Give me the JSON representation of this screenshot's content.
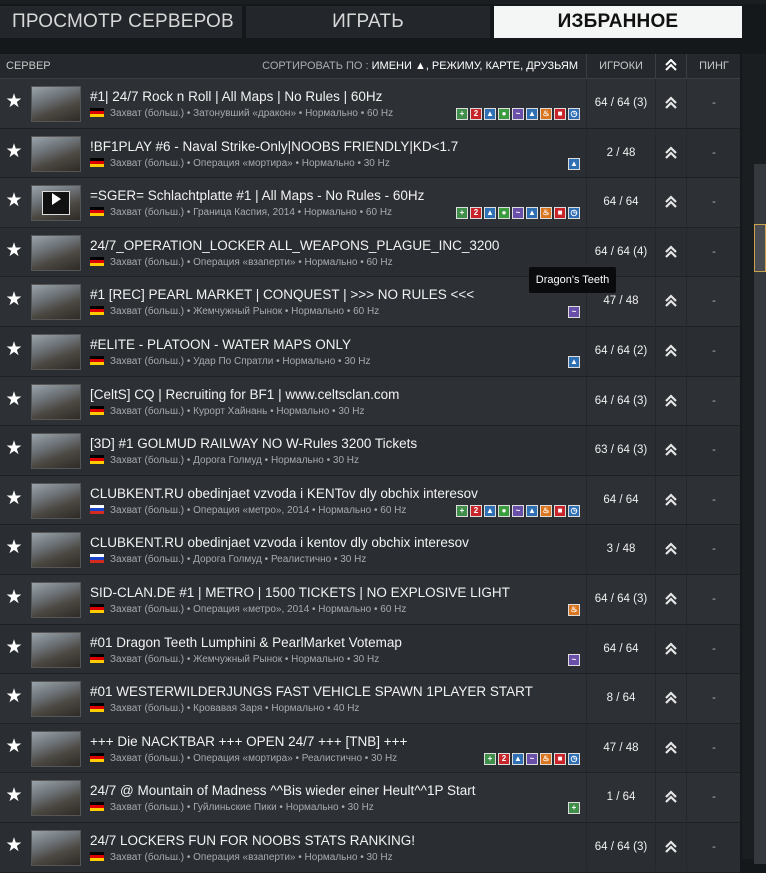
{
  "tabs": {
    "browse": "ПРОСМОТР СЕРВЕРОВ",
    "play": "ИГРАТЬ",
    "favorites": "ИЗБРАННОЕ"
  },
  "header": {
    "server": "СЕРВЕР",
    "sort_label": "СОРТИРОВАТЬ ПО :",
    "sort_options": "ИМЕНИ ▲, РЕЖИМУ, КАРТЕ, ДРУЗЬЯМ",
    "players": "ИГРОКИ",
    "ping": "ПИНГ"
  },
  "tooltip": "Dragon's Teeth",
  "servers": [
    {
      "name": "#1| 24/7 Rock n Roll | All Maps | No Rules | 60Hz",
      "sub": "Захват (больш.) • Затонувший «дракон» • Нормально • 60 Hz",
      "flag": "de",
      "players": "64 / 64 (3)",
      "ping": "-",
      "tags": [
        "green-plus",
        "red-2",
        "blue-ship",
        "green-circle",
        "purple-wave",
        "blue-mountain",
        "orange-fire",
        "red-square",
        "blue-clock"
      ],
      "video": false
    },
    {
      "name": "!BF1PLAY #6 - Naval Strike-Only|NOOBS FRIENDLY|KD<1.7",
      "sub": "Захват (больш.) • Операция «мортира» • Нормально • 30 Hz",
      "flag": "de",
      "players": "2 / 48",
      "ping": "-",
      "tags": [
        "blue-mountain"
      ],
      "video": false
    },
    {
      "name": "=SGER= Schlachtplatte #1 | All Maps - No Rules - 60Hz",
      "sub": "Захват (больш.) • Граница Каспия, 2014 • Нормально • 60 Hz",
      "flag": "de",
      "players": "64 / 64",
      "ping": "-",
      "tags": [
        "green-plus",
        "red-2",
        "blue-ship",
        "green-circle",
        "purple-wave",
        "blue-mountain",
        "orange-fire",
        "red-square",
        "blue-clock"
      ],
      "video": true
    },
    {
      "name": "24/7_OPERATION_LOCKER ALL_WEAPONS_PLAGUE_INC_3200",
      "sub": "Захват (больш.) • Операция «взаперти» • Нормально • 60 Hz",
      "flag": "de",
      "players": "64 / 64 (4)",
      "ping": "-",
      "tags": [],
      "video": false
    },
    {
      "name": "#1 [REC] PEARL MARKET | CONQUEST | >>> NO RULES <<<",
      "sub": "Захват (больш.) • Жемчужный Рынок • Нормально • 60 Hz",
      "flag": "de",
      "players": "47 / 48",
      "ping": "-",
      "tags": [
        "purple-wave"
      ],
      "video": false
    },
    {
      "name": "#ELITE - PLATOON - WATER MAPS ONLY",
      "sub": "Захват (больш.) • Удар По Спратли • Нормально • 30 Hz",
      "flag": "de",
      "players": "64 / 64 (2)",
      "ping": "-",
      "tags": [
        "blue-mountain"
      ],
      "video": false
    },
    {
      "name": "[CeltS] CQ | Recruiting for BF1 | www.celtsclan.com",
      "sub": "Захват (больш.) • Курорт Хайнань • Нормально • 30 Hz",
      "flag": "de",
      "players": "64 / 64 (3)",
      "ping": "-",
      "tags": [],
      "video": false
    },
    {
      "name": "[3D] #1 GOLMUD RAILWAY NO W-Rules 3200 Tickets",
      "sub": "Захват (больш.) • Дорога Голмуд • Нормально • 30 Hz",
      "flag": "de",
      "players": "63 / 64 (3)",
      "ping": "-",
      "tags": [],
      "video": false
    },
    {
      "name": "CLUBKENT.RU obedinjaet vzvoda i KENTov dly obchix interesov",
      "sub": "Захват (больш.) • Операция «метро», 2014 • Нормально • 60 Hz",
      "flag": "ru",
      "players": "64 / 64",
      "ping": "-",
      "tags": [
        "green-plus",
        "red-2",
        "blue-ship",
        "green-circle",
        "purple-wave",
        "blue-mountain",
        "orange-fire",
        "red-square",
        "blue-clock"
      ],
      "video": false
    },
    {
      "name": "CLUBKENT.RU obedinjaet vzvoda i kentov dly obchix interesov",
      "sub": "Захват (больш.) • Дорога Голмуд • Реалистично • 30 Hz",
      "flag": "ru",
      "players": "3 / 48",
      "ping": "-",
      "tags": [],
      "video": false
    },
    {
      "name": "SID-CLAN.DE #1 | METRO | 1500 TICKETS | NO EXPLOSIVE LIGHT",
      "sub": "Захват (больш.) • Операция «метро», 2014 • Нормально • 60 Hz",
      "flag": "de",
      "players": "64 / 64 (3)",
      "ping": "-",
      "tags": [
        "orange-fire"
      ],
      "video": false
    },
    {
      "name": "#01 Dragon Teeth Lumphini & PearlMarket Votemap",
      "sub": "Захват (больш.) • Жемчужный Рынок • Нормально • 30 Hz",
      "flag": "de",
      "players": "64 / 64",
      "ping": "-",
      "tags": [
        "purple-wave"
      ],
      "video": false
    },
    {
      "name": "#01 WESTERWILDERJUNGS FAST VEHICLE SPAWN 1PLAYER START",
      "sub": "Захват (больш.) • Кровавая Заря • Нормально • 40 Hz",
      "flag": "de",
      "players": "8 / 64",
      "ping": "-",
      "tags": [],
      "video": false
    },
    {
      "name": "+++ Die NACKTBAR +++ OPEN 24/7 +++ [TNB] +++",
      "sub": "Захват (больш.) • Операция «мортира» • Реалистично • 30 Hz",
      "flag": "de",
      "players": "47 / 48",
      "ping": "-",
      "tags": [
        "green-plus",
        "red-2",
        "blue-ship",
        "purple-wave",
        "orange-fire",
        "red-square",
        "blue-clock"
      ],
      "video": false
    },
    {
      "name": "24/7 @ Mountain of Madness ^^Bis wieder einer Heult^^1P Start",
      "sub": "Захват (больш.) • Гуйлиньские Пики • Нормально • 30 Hz",
      "flag": "de",
      "players": "1 / 64",
      "ping": "-",
      "tags": [
        "green-plus"
      ],
      "video": false
    },
    {
      "name": "24/7 LOCKERS FUN FOR NOOBS STATS RANKING!",
      "sub": "Захват (больш.) • Операция «взаперти» • Нормально • 30 Hz",
      "flag": "de",
      "players": "64 / 64 (3)",
      "ping": "-",
      "tags": [],
      "video": false
    }
  ],
  "tag_colors": {
    "green-plus": "#3f8f4a",
    "red-2": "#c8252b",
    "blue-ship": "#2f6fb3",
    "green-circle": "#3a9b3f",
    "purple-wave": "#6a4fa8",
    "blue-mountain": "#2f6fb3",
    "orange-fire": "#d9741f",
    "red-square": "#c8252b",
    "blue-clock": "#2f6fb3"
  },
  "tag_glyphs": {
    "green-plus": "+",
    "red-2": "2",
    "blue-ship": "▲",
    "green-circle": "●",
    "purple-wave": "~",
    "blue-mountain": "▲",
    "orange-fire": "♨",
    "red-square": "■",
    "blue-clock": "◷"
  }
}
